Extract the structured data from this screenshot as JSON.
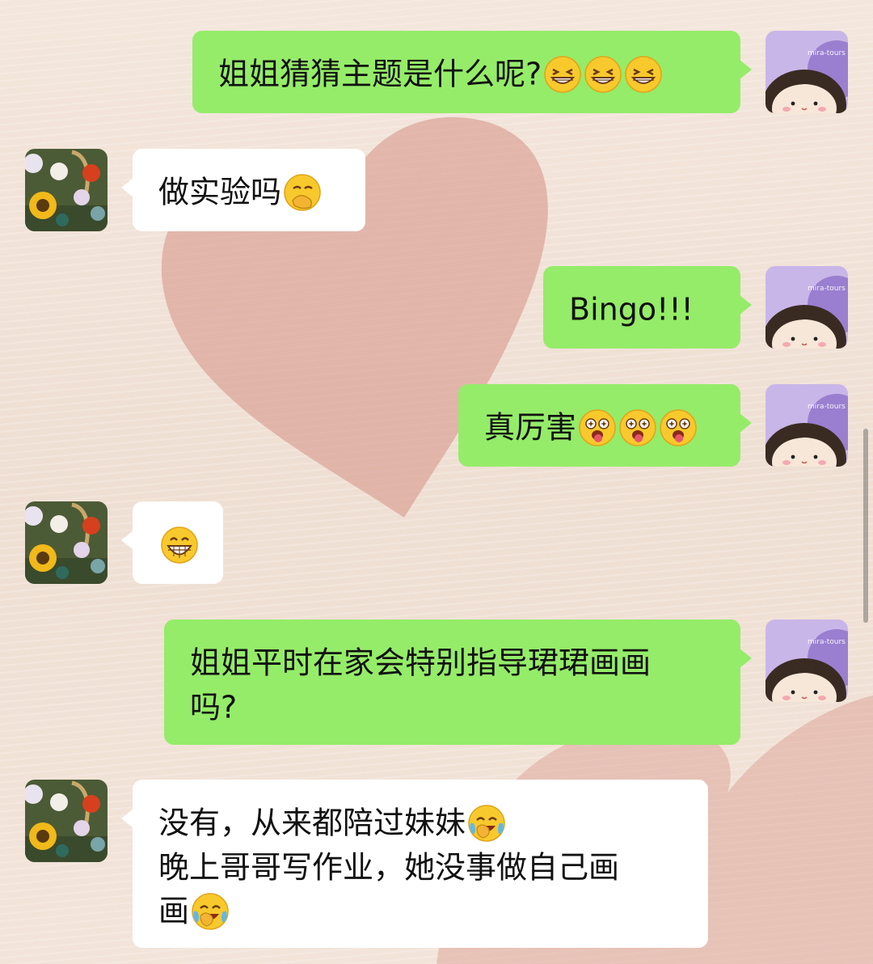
{
  "chat": {
    "messages": [
      {
        "sender": "me",
        "avatar": "avatar-girl-cartoon",
        "lines": [
          {
            "text": "姐姐猜猜主题是什么呢?",
            "emojis": [
              "grinning-squint-icon",
              "grinning-squint-icon",
              "grinning-squint-icon"
            ]
          }
        ]
      },
      {
        "sender": "them",
        "avatar": "avatar-sunflower-bouquet",
        "lines": [
          {
            "text": "做实验吗",
            "emojis": [
              "hand-over-mouth-icon"
            ]
          }
        ]
      },
      {
        "sender": "me",
        "avatar": "avatar-girl-cartoon",
        "lines": [
          {
            "text": "Bingo!!!",
            "emojis": []
          }
        ]
      },
      {
        "sender": "me",
        "avatar": "avatar-girl-cartoon",
        "lines": [
          {
            "text": "真厉害",
            "emojis": [
              "starry-eyed-tongue-icon",
              "starry-eyed-tongue-icon",
              "starry-eyed-tongue-icon"
            ]
          }
        ]
      },
      {
        "sender": "them",
        "avatar": "avatar-sunflower-bouquet",
        "lines": [
          {
            "text": "",
            "emojis": [
              "big-grin-icon"
            ]
          }
        ]
      },
      {
        "sender": "me",
        "avatar": "avatar-girl-cartoon",
        "lines": [
          {
            "text": "姐姐平时在家会特别指导珺珺画画",
            "emojis": []
          },
          {
            "text": "吗?",
            "emojis": []
          }
        ]
      },
      {
        "sender": "them",
        "avatar": "avatar-sunflower-bouquet",
        "lines": [
          {
            "text": "没有，从来都陪过妹妹",
            "emojis": [
              "laughing-tears-icon"
            ]
          },
          {
            "text": "晚上哥哥写作业，她没事做自己画",
            "emojis": []
          },
          {
            "text": "画",
            "emojis": [
              "laughing-tears-icon"
            ]
          }
        ]
      }
    ]
  },
  "avatar_girl": {
    "watermark": "mira-tours"
  },
  "colors": {
    "me_bubble": "#95ec69",
    "them_bubble": "#ffffff",
    "background": "#f1e2d6",
    "heart": "#d99a8e"
  }
}
